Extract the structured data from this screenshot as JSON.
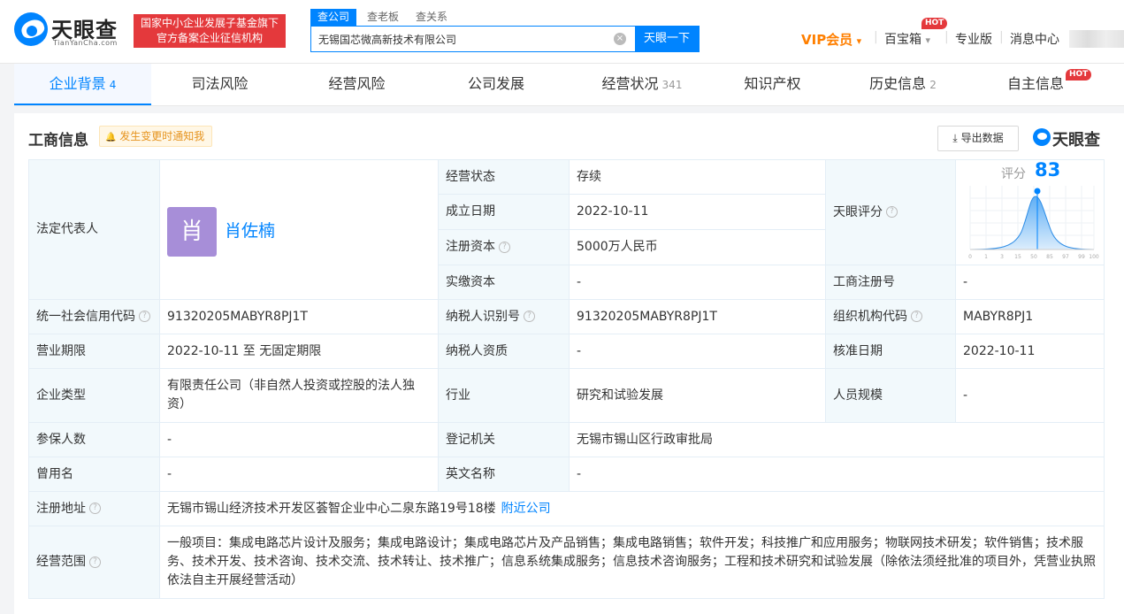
{
  "header": {
    "logo_text": "天眼查",
    "logo_sub": "TianYanCha.com",
    "badge_line1": "国家中小企业发展子基金旗下",
    "badge_line2": "官方备案企业征信机构",
    "search_tabs": [
      "查公司",
      "查老板",
      "查关系"
    ],
    "search_value": "无锡国芯微高新技术有限公司",
    "search_clear": "×",
    "search_button": "天眼一下",
    "vip_label": "VIP会员",
    "vip_caret": "▾",
    "baibao_label": "百宝箱",
    "baibao_caret": "▾",
    "hot_badge": "HOT",
    "pro_label": "专业版",
    "msg_label": "消息中心",
    "sep": "|"
  },
  "tabs": [
    {
      "label": "企业背景",
      "count": "4"
    },
    {
      "label": "司法风险",
      "count": ""
    },
    {
      "label": "经营风险",
      "count": ""
    },
    {
      "label": "公司发展",
      "count": ""
    },
    {
      "label": "经营状况",
      "count": "341"
    },
    {
      "label": "知识产权",
      "count": ""
    },
    {
      "label": "历史信息",
      "count": "2"
    },
    {
      "label": "自主信息",
      "count": ""
    }
  ],
  "tab_hot": "HOT",
  "panel": {
    "title": "工商信息",
    "notify": "发生变更时通知我",
    "notify_icon": "🔔",
    "export": "导出数据",
    "export_icon": "⤓",
    "logo_text": "天眼查"
  },
  "info": {
    "legal_rep_label": "法定代表人",
    "legal_rep_avatar": "肖",
    "legal_rep_name": "肖佐楠",
    "status_label": "经营状态",
    "status_value": "存续",
    "found_label": "成立日期",
    "found_value": "2022-10-11",
    "reg_cap_label": "注册资本",
    "reg_cap_value": "5000万人民币",
    "paid_cap_label": "实缴资本",
    "paid_cap_value": "-",
    "score_label_cell": "天眼评分",
    "score_label": "评分",
    "score_value": "83",
    "score_ticks": [
      "0",
      "1",
      "3",
      "15",
      "50",
      "85",
      "97",
      "99",
      "100"
    ],
    "biz_reg_label": "工商注册号",
    "biz_reg_value": "-",
    "credit_code_label": "统一社会信用代码",
    "credit_code_value": "91320205MABYR8PJ1T",
    "taxpayer_id_label": "纳税人识别号",
    "taxpayer_id_value": "91320205MABYR8PJ1T",
    "org_code_label": "组织机构代码",
    "org_code_value": "MABYR8PJ1",
    "term_label": "营业期限",
    "term_value": "2022-10-11 至 无固定期限",
    "taxpayer_qual_label": "纳税人资质",
    "taxpayer_qual_value": "-",
    "approve_label": "核准日期",
    "approve_value": "2022-10-11",
    "type_label": "企业类型",
    "type_value": "有限责任公司（非自然人投资或控股的法人独资）",
    "industry_label": "行业",
    "industry_value": "研究和试验发展",
    "staff_label": "人员规模",
    "staff_value": "-",
    "insured_label": "参保人数",
    "insured_value": "-",
    "authority_label": "登记机关",
    "authority_value": "无锡市锡山区行政审批局",
    "former_label": "曾用名",
    "former_value": "-",
    "english_label": "英文名称",
    "english_value": "-",
    "address_label": "注册地址",
    "address_value": "无锡市锡山经济技术开发区荟智企业中心二泉东路19号18楼",
    "nearby_link": "附近公司",
    "scope_label": "经营范围",
    "scope_value": "一般项目：集成电路芯片设计及服务；集成电路设计；集成电路芯片及产品销售；集成电路销售；软件开发；科技推广和应用服务；物联网技术研发；软件销售；技术服务、技术开发、技术咨询、技术交流、技术转让、技术推广；信息系统集成服务；信息技术咨询服务；工程和技术研究和试验发展（除依法须经批准的项目外，凭营业执照依法自主开展经营活动）",
    "help_icon": "?"
  },
  "colors": {
    "accent": "#0084ff",
    "hot": "#e4393c",
    "vip": "#ff7f00",
    "cell_key_bg": "#f2f9fc"
  }
}
